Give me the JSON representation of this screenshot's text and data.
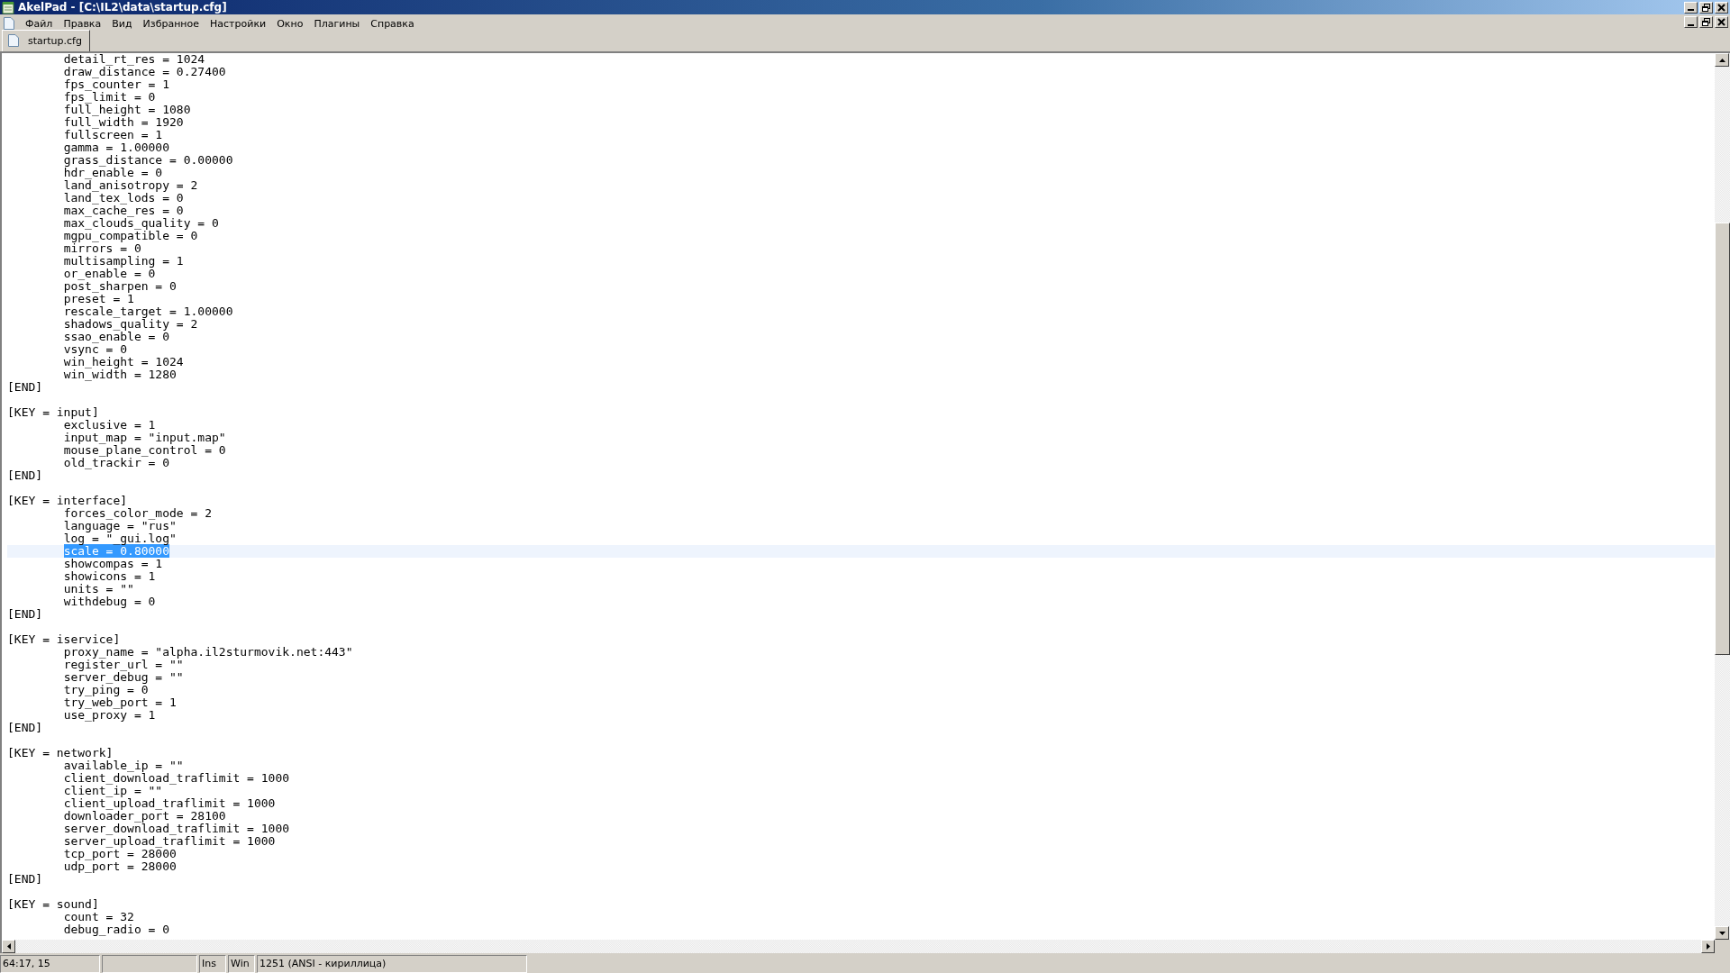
{
  "window": {
    "title": "AkelPad - [C:\\IL2\\data\\startup.cfg]"
  },
  "menu": [
    "Файл",
    "Правка",
    "Вид",
    "Избранное",
    "Настройки",
    "Окно",
    "Плагины",
    "Справка"
  ],
  "tabs": [
    {
      "label": "startup.cfg",
      "selected": true
    }
  ],
  "lines": [
    {
      "text": "\tdetail_rt_res = 1024",
      "selected": false
    },
    {
      "text": "\tdraw_distance = 0.27400",
      "selected": false
    },
    {
      "text": "\tfps_counter = 1",
      "selected": false
    },
    {
      "text": "\tfps_limit = 0",
      "selected": false
    },
    {
      "text": "\tfull_height = 1080",
      "selected": false
    },
    {
      "text": "\tfull_width = 1920",
      "selected": false
    },
    {
      "text": "\tfullscreen = 1",
      "selected": false
    },
    {
      "text": "\tgamma = 1.00000",
      "selected": false
    },
    {
      "text": "\tgrass_distance = 0.00000",
      "selected": false
    },
    {
      "text": "\thdr_enable = 0",
      "selected": false
    },
    {
      "text": "\tland_anisotropy = 2",
      "selected": false
    },
    {
      "text": "\tland_tex_lods = 0",
      "selected": false
    },
    {
      "text": "\tmax_cache_res = 0",
      "selected": false
    },
    {
      "text": "\tmax_clouds_quality = 0",
      "selected": false
    },
    {
      "text": "\tmgpu_compatible = 0",
      "selected": false
    },
    {
      "text": "\tmirrors = 0",
      "selected": false
    },
    {
      "text": "\tmultisampling = 1",
      "selected": false
    },
    {
      "text": "\tor_enable = 0",
      "selected": false
    },
    {
      "text": "\tpost_sharpen = 0",
      "selected": false
    },
    {
      "text": "\tpreset = 1",
      "selected": false
    },
    {
      "text": "\trescale_target = 1.00000",
      "selected": false
    },
    {
      "text": "\tshadows_quality = 2",
      "selected": false
    },
    {
      "text": "\tssao_enable = 0",
      "selected": false
    },
    {
      "text": "\tvsync = 0",
      "selected": false
    },
    {
      "text": "\twin_height = 1024",
      "selected": false
    },
    {
      "text": "\twin_width = 1280",
      "selected": false
    },
    {
      "text": "[END]",
      "selected": false
    },
    {
      "selected": false
    },
    {
      "text": "[KEY = input]",
      "selected": false
    },
    {
      "text": "\texclusive = 1",
      "selected": false
    },
    {
      "text": "\tinput_map = \"input.map\"",
      "selected": false
    },
    {
      "text": "\tmouse_plane_control = 0",
      "selected": false
    },
    {
      "text": "\told_trackir = 0",
      "selected": false
    },
    {
      "text": "[END]",
      "selected": false
    },
    {
      "selected": false
    },
    {
      "text": "[KEY = interface]",
      "selected": false
    },
    {
      "text": "\tforces_color_mode = 2",
      "selected": false
    },
    {
      "text": "\tlanguage = \"rus\"",
      "selected": false
    },
    {
      "text": "\tlog = \"_gui.log\"",
      "selected": false
    },
    {
      "text": "\tscale = 0.80000",
      "selected": true
    },
    {
      "text": "\tshowcompas = 1",
      "selected": false
    },
    {
      "text": "\tshowicons = 1",
      "selected": false
    },
    {
      "text": "\tunits = \"\"",
      "selected": false
    },
    {
      "text": "\twithdebug = 0",
      "selected": false
    },
    {
      "text": "[END]",
      "selected": false
    },
    {
      "selected": false
    },
    {
      "text": "[KEY = iservice]",
      "selected": false
    },
    {
      "text": "\tproxy_name = \"alpha.il2sturmovik.net:443\"",
      "selected": false
    },
    {
      "text": "\tregister_url = \"\"",
      "selected": false
    },
    {
      "text": "\tserver_debug = \"\"",
      "selected": false
    },
    {
      "text": "\ttry_ping = 0",
      "selected": false
    },
    {
      "text": "\ttry_web_port = 1",
      "selected": false
    },
    {
      "text": "\tuse_proxy = 1",
      "selected": false
    },
    {
      "text": "[END]",
      "selected": false
    },
    {
      "selected": false
    },
    {
      "text": "[KEY = network]",
      "selected": false
    },
    {
      "text": "\tavailable_ip = \"\"",
      "selected": false
    },
    {
      "text": "\tclient_download_traflimit = 1000",
      "selected": false
    },
    {
      "text": "\tclient_ip = \"\"",
      "selected": false
    },
    {
      "text": "\tclient_upload_traflimit = 1000",
      "selected": false
    },
    {
      "text": "\tdownloader_port = 28100",
      "selected": false
    },
    {
      "text": "\tserver_download_traflimit = 1000",
      "selected": false
    },
    {
      "text": "\tserver_upload_traflimit = 1000",
      "selected": false
    },
    {
      "text": "\ttcp_port = 28000",
      "selected": false
    },
    {
      "text": "\tudp_port = 28000",
      "selected": false
    },
    {
      "text": "[END]",
      "selected": false
    },
    {
      "selected": false
    },
    {
      "text": "[KEY = sound]",
      "selected": false
    },
    {
      "text": "\tcount = 32",
      "selected": false
    },
    {
      "text": "\tdebug_radio = 0",
      "selected": false
    }
  ],
  "status_bar": {
    "position": "64:17, 15",
    "insert_mode": "Ins",
    "line_ending": "Win",
    "encoding": "1251  (ANSI - кириллица)"
  }
}
